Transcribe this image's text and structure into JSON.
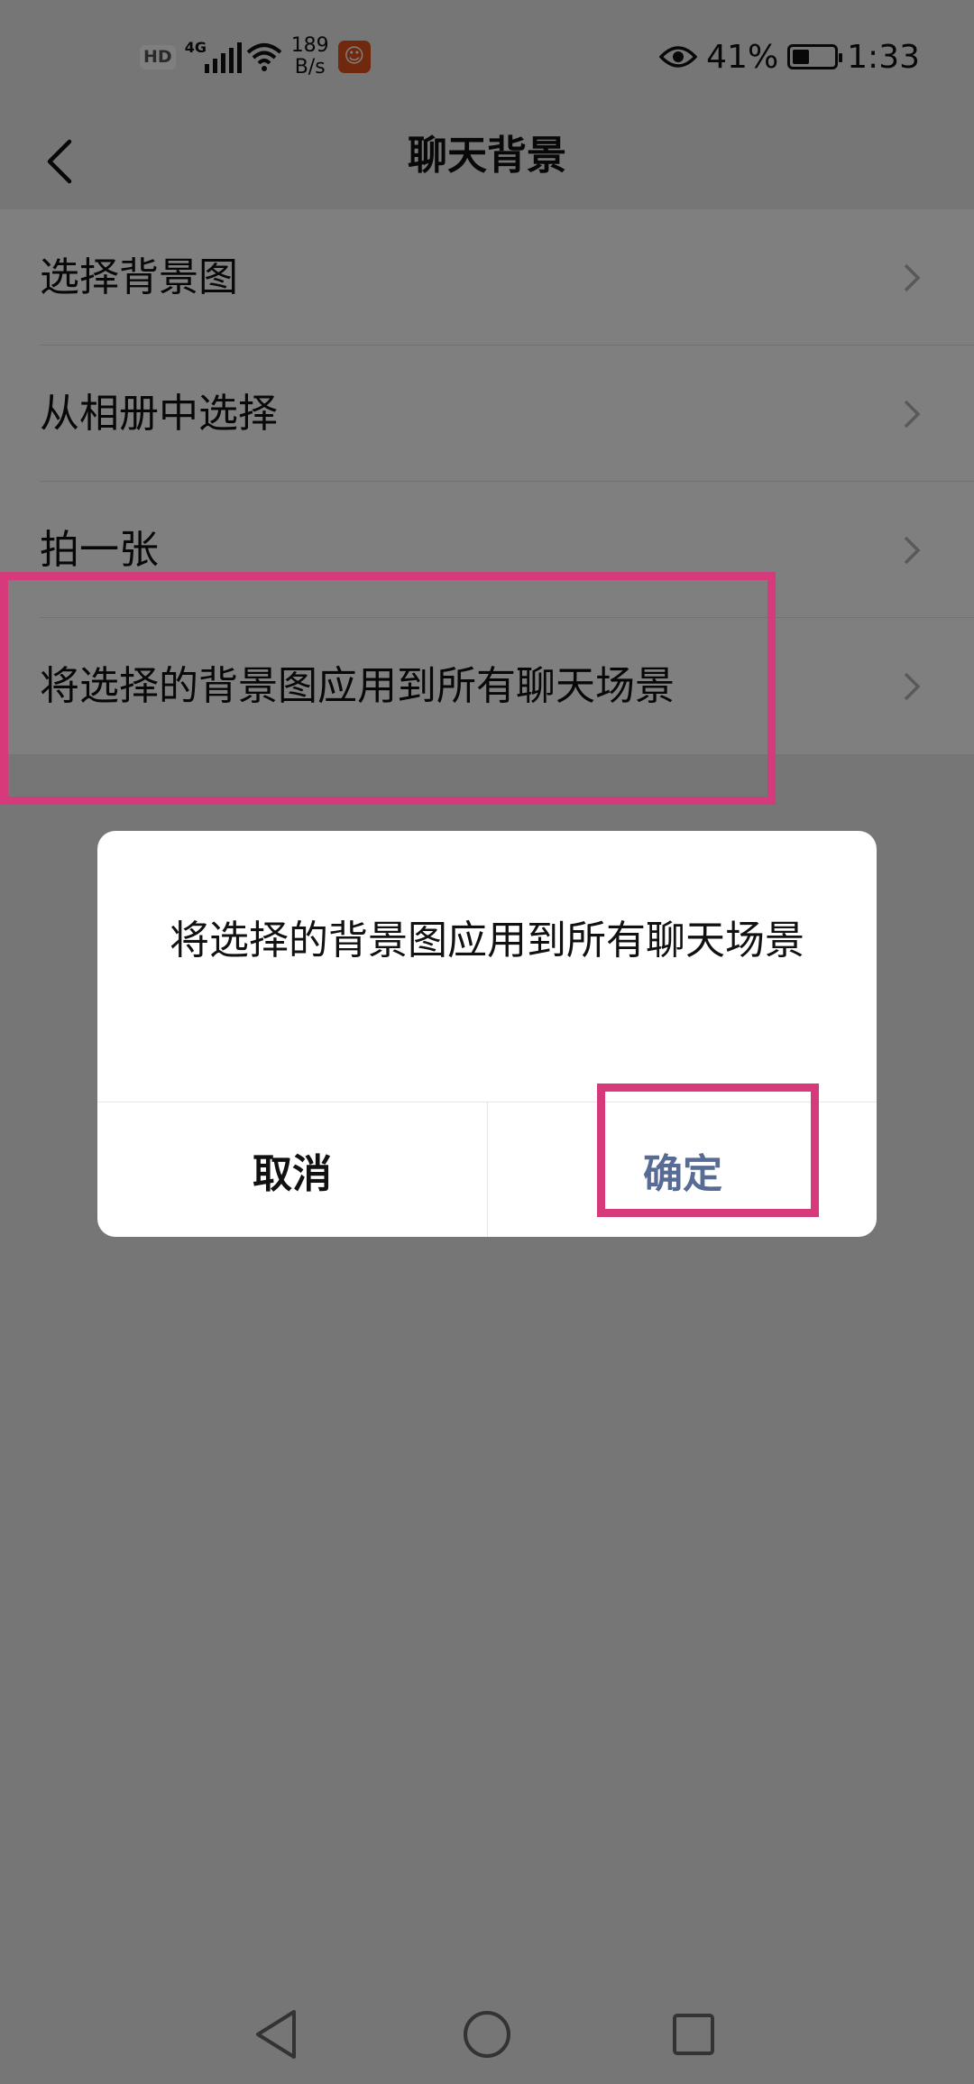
{
  "status_bar": {
    "hd": "HD",
    "network": "4G",
    "speed_value": "189",
    "speed_unit": "B/s",
    "battery": "41%",
    "battery_fraction": 0.41,
    "time": "1:33",
    "icons": [
      "hd-icon",
      "signal-icon",
      "wifi-icon",
      "app-notification-icon",
      "eye-icon",
      "battery-icon"
    ]
  },
  "header": {
    "title": "聊天背景"
  },
  "settings": [
    {
      "label": "选择背景图"
    },
    {
      "label": "从相册中选择"
    },
    {
      "label": "拍一张"
    },
    {
      "label": "将选择的背景图应用到所有聊天场景"
    }
  ],
  "dialog": {
    "message": "将选择的背景图应用到所有聊天场景",
    "cancel_label": "取消",
    "confirm_label": "确定"
  },
  "colors": {
    "annotation": "#d63a7a",
    "confirm": "#576b95",
    "overlay": "rgba(0,0,0,0.5)"
  }
}
